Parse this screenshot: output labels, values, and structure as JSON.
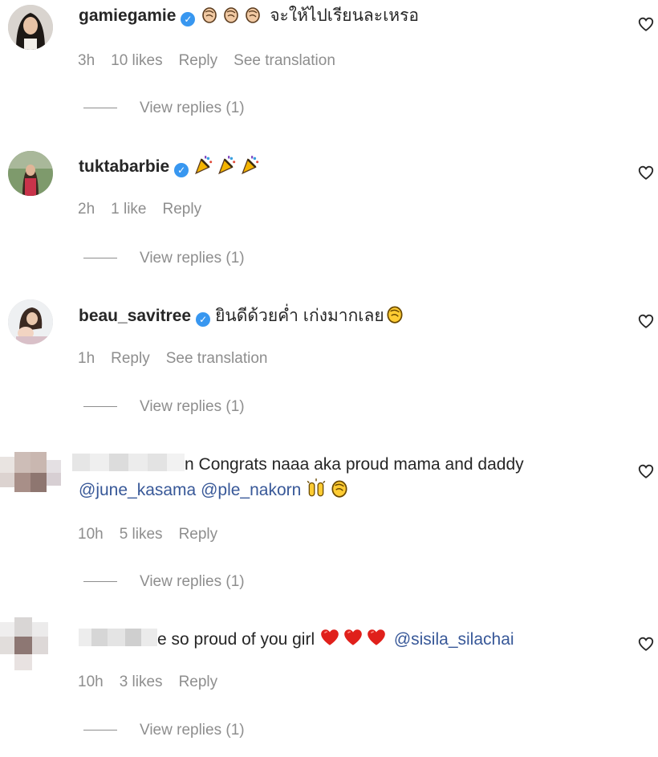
{
  "comments": [
    {
      "username": "gamiegamie",
      "verified": true,
      "text": "จะให้ไปเรียนละเหรอ",
      "emoji_count": 3,
      "time": "3h",
      "likes": "10 likes",
      "reply": "Reply",
      "translate": "See translation",
      "view_replies": "View replies (1)"
    },
    {
      "username": "tuktabarbie",
      "verified": true,
      "text": "",
      "emoji_count": 3,
      "time": "2h",
      "likes": "1 like",
      "reply": "Reply",
      "view_replies": "View replies (1)"
    },
    {
      "username": "beau_savitree",
      "verified": true,
      "text": "ยินดีด้วยค่ำ เก่งมากเลย",
      "time": "1h",
      "reply": "Reply",
      "translate": "See translation",
      "view_replies": "View replies (1)"
    },
    {
      "username_partial": "n",
      "text": "Congrats naaa aka proud mama and daddy",
      "mention1": "@june_kasama",
      "mention2": "@ple_nakorn",
      "time": "10h",
      "likes": "5 likes",
      "reply": "Reply",
      "view_replies": "View replies (1)"
    },
    {
      "username_partial": "e",
      "text": "so proud of you girl",
      "mention1": "@sisila_silachai",
      "time": "10h",
      "likes": "3 likes",
      "reply": "Reply",
      "view_replies": "View replies (1)"
    }
  ],
  "icons": {
    "verified": "verified-badge-icon",
    "heart": "heart-outline-icon",
    "clap": "clapping-hands-emoji",
    "party": "party-popper-emoji",
    "raise": "raising-hands-emoji",
    "red_heart": "red-heart-emoji"
  },
  "colors": {
    "verified": "#3897f0",
    "mention": "#385898",
    "meta": "#8e8e8e"
  }
}
